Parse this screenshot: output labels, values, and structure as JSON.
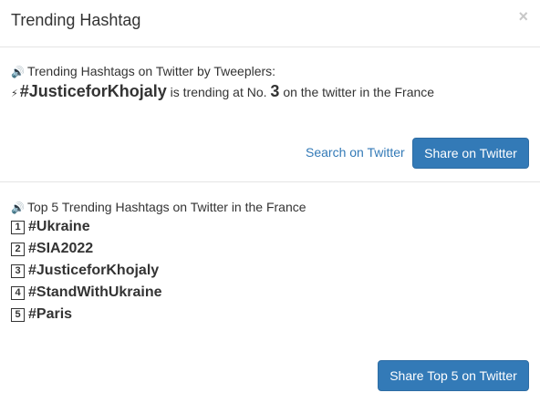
{
  "modal": {
    "title": "Trending Hashtag",
    "close_label": "×"
  },
  "trending": {
    "subheading": "Trending Hashtags on Twitter by Tweeplers:",
    "speaker_glyph": "🔊",
    "bolt_glyph": "⚡",
    "hashtag": "#JusticeforKhojaly",
    "text_before_rank": " is trending at No. ",
    "rank": "3",
    "text_after_rank": " on the twitter in the France",
    "search_link": "Search on Twitter",
    "share_button": "Share on Twitter"
  },
  "top5": {
    "subheading": "Top 5 Trending Hashtags on Twitter in the France",
    "items": [
      {
        "num": "1",
        "tag": "#Ukraine"
      },
      {
        "num": "2",
        "tag": "#SIA2022"
      },
      {
        "num": "3",
        "tag": "#JusticeforKhojaly"
      },
      {
        "num": "4",
        "tag": "#StandWithUkraine"
      },
      {
        "num": "5",
        "tag": "#Paris"
      }
    ],
    "share_button": "Share Top 5 on Twitter"
  },
  "colors": {
    "accent": "#337ab7",
    "divider": "#e5e5e5"
  },
  "icons": {
    "speaker": "speaker-icon",
    "bolt": "lightning-icon",
    "close": "close-icon"
  }
}
